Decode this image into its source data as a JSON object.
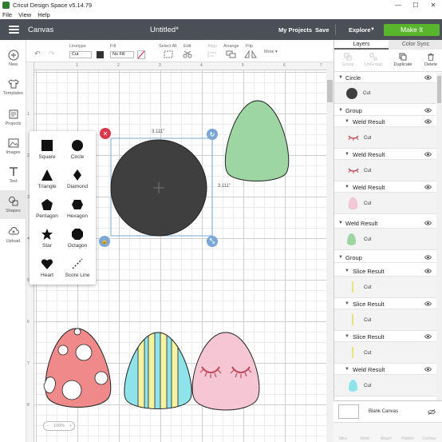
{
  "window": {
    "title": "Cricut Design Space  v5.14.79",
    "minimize": "—",
    "maximize": "☐",
    "close": "✕"
  },
  "menubar": {
    "items": [
      "File",
      "View",
      "Help"
    ]
  },
  "header": {
    "section": "Canvas",
    "doc_title": "Untitled*",
    "my_projects": "My Projects",
    "save": "Save",
    "explore": "Explore",
    "make_it": "Make It",
    "make_it_color": "#5ab52e"
  },
  "leftbar": {
    "items": [
      {
        "label": "New",
        "icon": "plus-circle-icon"
      },
      {
        "label": "Templates",
        "icon": "shirt-icon"
      },
      {
        "label": "Projects",
        "icon": "folder-icon"
      },
      {
        "label": "Images",
        "icon": "image-icon"
      },
      {
        "label": "Text",
        "icon": "text-t-icon"
      },
      {
        "label": "Shapes",
        "icon": "shapes-icon"
      },
      {
        "label": "Upload",
        "icon": "upload-cloud-icon"
      }
    ]
  },
  "toolbar": {
    "linetype_label": "Linetype",
    "linetype_value": "Cut",
    "fill_label": "Fill",
    "fill_value": "No Fill",
    "select_all": "Select All",
    "edit": "Edit",
    "align": "Align",
    "arrange": "Arrange",
    "flip": "Flip",
    "more": "More ▾"
  },
  "ruler": {
    "top": [
      "1",
      "2",
      "3",
      "4",
      "5",
      "6",
      "7"
    ],
    "left": [
      "1",
      "2",
      "3",
      "4",
      "5",
      "6",
      "7",
      "8"
    ]
  },
  "shapes_panel": {
    "items": [
      {
        "label": "Square",
        "icon": "square-icon"
      },
      {
        "label": "Circle",
        "icon": "circle-icon"
      },
      {
        "label": "Triangle",
        "icon": "triangle-icon"
      },
      {
        "label": "Diamond",
        "icon": "diamond-icon"
      },
      {
        "label": "Pentagon",
        "icon": "pentagon-icon"
      },
      {
        "label": "Hexagon",
        "icon": "hexagon-icon"
      },
      {
        "label": "Star",
        "icon": "star-icon"
      },
      {
        "label": "Octagon",
        "icon": "octagon-icon"
      },
      {
        "label": "Heart",
        "icon": "heart-icon"
      },
      {
        "label": "Score Line",
        "icon": "score-line-icon"
      }
    ]
  },
  "selection": {
    "width_label": "3.111\"",
    "height_label": "3.111\""
  },
  "canvas_colors": {
    "circle": "#3f3f3f",
    "green_egg": "#9dd6a3",
    "pink_egg": "#f5c6d3",
    "red_egg": "#f08a8a",
    "stripe_blue": "#8fe3ea",
    "stripe_yellow": "#f6f3a0",
    "handle_red": "#d9374b",
    "handle_blue": "#7aa7d6"
  },
  "zoom": {
    "minus": "−",
    "value": "100%",
    "plus": "+"
  },
  "right_panel": {
    "tabs": [
      "Layers",
      "Color Sync"
    ],
    "actions": [
      "Group",
      "UnGroup",
      "Duplicate",
      "Delete"
    ],
    "layers": [
      {
        "title": "Circle",
        "level": 0,
        "children": [
          {
            "label": "Cut",
            "thumb": "dark-circle"
          }
        ]
      },
      {
        "title": "Group",
        "level": 0,
        "children": []
      },
      {
        "title": "Weld Result",
        "level": 1,
        "children": [
          {
            "label": "Cut",
            "thumb": "lashes"
          }
        ]
      },
      {
        "title": "Weld Result",
        "level": 1,
        "children": [
          {
            "label": "Cut",
            "thumb": "lashes"
          }
        ]
      },
      {
        "title": "Weld Result",
        "level": 1,
        "children": [
          {
            "label": "Cut",
            "thumb": "pink-egg"
          }
        ]
      },
      {
        "title": "Weld Result",
        "level": 0,
        "children": [
          {
            "label": "Cut",
            "thumb": "green-egg"
          }
        ]
      },
      {
        "title": "Group",
        "level": 0,
        "children": []
      },
      {
        "title": "Slice Result",
        "level": 1,
        "children": [
          {
            "label": "Cut",
            "thumb": "yellow-stripe"
          }
        ]
      },
      {
        "title": "Slice Result",
        "level": 1,
        "children": [
          {
            "label": "Cut",
            "thumb": "yellow-stripe"
          }
        ]
      },
      {
        "title": "Slice Result",
        "level": 1,
        "children": [
          {
            "label": "Cut",
            "thumb": "yellow-stripe"
          }
        ]
      },
      {
        "title": "Weld Result",
        "level": 1,
        "children": [
          {
            "label": "Cut",
            "thumb": "blue-egg"
          }
        ]
      }
    ],
    "blank_canvas": "Blank Canvas",
    "bottom_actions": [
      "Slice",
      "Weld",
      "Attach",
      "Flatten",
      "Contour"
    ]
  }
}
